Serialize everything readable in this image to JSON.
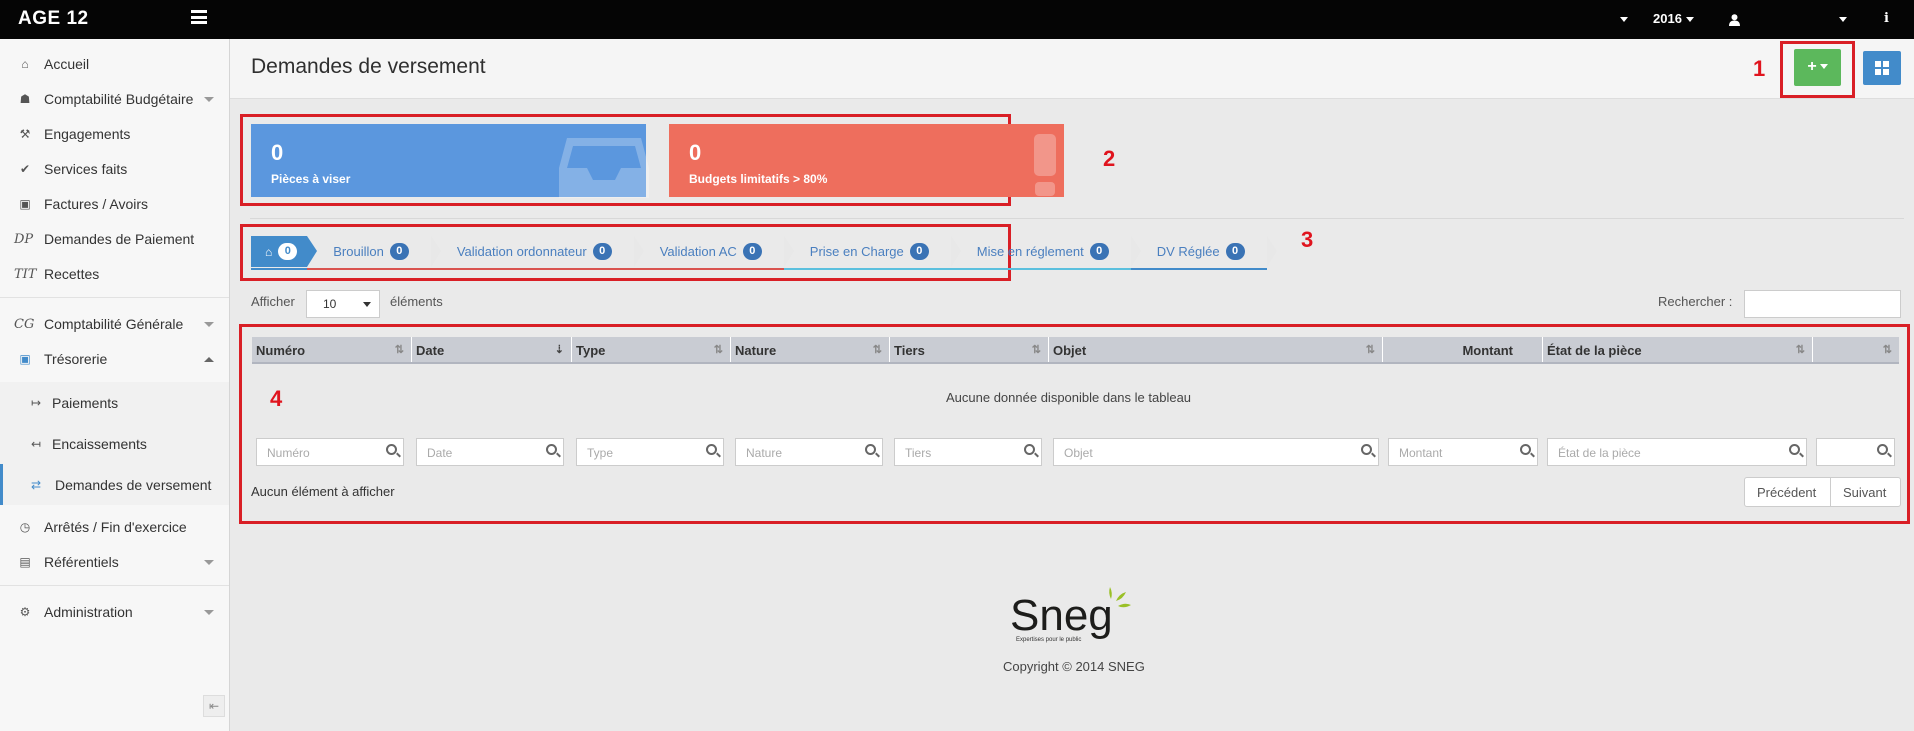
{
  "topbar": {
    "brand": "AGE 12",
    "year": "2016"
  },
  "sidebar": {
    "items": [
      {
        "label": "Accueil",
        "icon": "home-icon"
      },
      {
        "label": "Comptabilité Budgétaire",
        "icon": "sitemap-icon"
      },
      {
        "label": "Engagements",
        "icon": "gavel-icon"
      },
      {
        "label": "Services faits",
        "icon": "check-icon"
      },
      {
        "label": "Factures / Avoirs",
        "icon": "money-icon"
      },
      {
        "label": "Demandes de Paiement",
        "icon_text": "DP"
      },
      {
        "label": "Recettes",
        "icon_text": "TIT"
      },
      {
        "label": "Comptabilité Générale",
        "icon_text": "CG"
      },
      {
        "label": "Trésorerie",
        "icon": "money-icon"
      },
      {
        "label": "Paiements",
        "icon": "sign-out-icon"
      },
      {
        "label": "Encaissements",
        "icon": "sign-in-icon"
      },
      {
        "label": "Demandes de versement",
        "icon": "exchange-icon"
      },
      {
        "label": "Arrêtés / Fin d'exercice",
        "icon": "clock-icon"
      },
      {
        "label": "Référentiels",
        "icon": "book-icon"
      },
      {
        "label": "Administration",
        "icon": "cogs-icon"
      }
    ]
  },
  "page": {
    "title": "Demandes de versement"
  },
  "annotations": [
    "1",
    "2",
    "3",
    "4"
  ],
  "stats": [
    {
      "value": "0",
      "label": "Pièces à viser",
      "color": "#5b97de"
    },
    {
      "value": "0",
      "label": "Budgets limitatifs > 80%",
      "color": "#ee6e5d"
    }
  ],
  "steps": [
    {
      "label": "",
      "count": "0"
    },
    {
      "label": "Brouillon",
      "count": "0"
    },
    {
      "label": "Validation ordonnateur",
      "count": "0"
    },
    {
      "label": "Validation AC",
      "count": "0"
    },
    {
      "label": "Prise en Charge",
      "count": "0"
    },
    {
      "label": "Mise en réglement",
      "count": "0"
    },
    {
      "label": "DV Réglée",
      "count": "0"
    }
  ],
  "table": {
    "show_prefix": "Afficher",
    "show_value": "10",
    "show_suffix": "éléments",
    "search_label": "Rechercher :",
    "columns": [
      "Numéro",
      "Date",
      "Type",
      "Nature",
      "Tiers",
      "Objet",
      "Montant",
      "État de la pièce",
      ""
    ],
    "empty_message": "Aucune donnée disponible dans le tableau",
    "filters": [
      "Numéro",
      "Date",
      "Type",
      "Nature",
      "Tiers",
      "Objet",
      "Montant",
      "État de la pièce",
      ""
    ],
    "info": "Aucun élément à afficher",
    "prev": "Précédent",
    "next": "Suivant"
  },
  "footer": {
    "logo_text": "Sneg",
    "logo_tagline": "Expertises pour le public",
    "copyright": "Copyright © 2014 SNEG"
  }
}
